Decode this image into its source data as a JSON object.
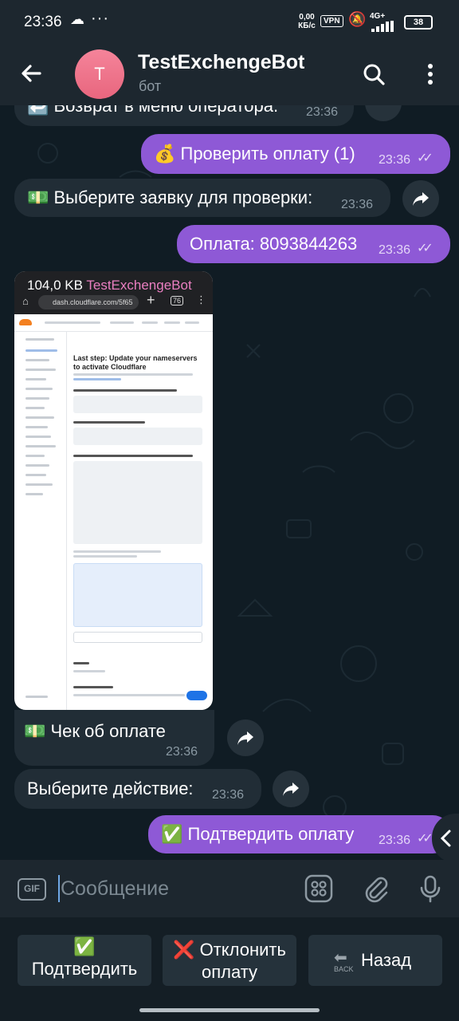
{
  "status_bar": {
    "time": "23:36",
    "speed_value": "0,00",
    "speed_unit": "КБ/с",
    "vpn": "VPN",
    "network": "4G+",
    "battery": "38"
  },
  "header": {
    "avatar_letter": "T",
    "title": "TestExchengeBot",
    "subtitle": "бот"
  },
  "messages": [
    {
      "text": "↩️ Возврат в меню оператора.",
      "time": "23:36"
    },
    {
      "text": "💰 Проверить оплату (1)",
      "time": "23:36"
    },
    {
      "text": "💵 Выберите заявку для проверки:",
      "time": "23:36"
    },
    {
      "text": "Оплата: 8093844263",
      "time": "23:36"
    },
    {
      "text": "💵 Чек об оплате",
      "time": "23:36"
    },
    {
      "text": "Выберите действие:",
      "time": "23:36"
    },
    {
      "text": "✅ Подтвердить оплату",
      "time": "23:36"
    }
  ],
  "photo": {
    "size": "104,0 KB",
    "sender": "TestExchengeBot",
    "url": "dash.cloudflare.com/5f65",
    "tabs": "76",
    "page_heading": "Last step: Update your nameservers to activate Cloudflare"
  },
  "input": {
    "gif_label": "GIF",
    "placeholder": "Сообщение"
  },
  "keyboard": {
    "confirm_emoji": "✅",
    "confirm_label": "Подтвердить",
    "reject_emoji": "❌",
    "reject_line1": "Отклонить",
    "reject_line2": "оплату",
    "back_emoji_label": "BACK",
    "back_label": "Назад"
  },
  "colors": {
    "outgoing_bubble": "#8e59d6",
    "incoming_bubble": "#212d36",
    "header": "#1d272f"
  }
}
